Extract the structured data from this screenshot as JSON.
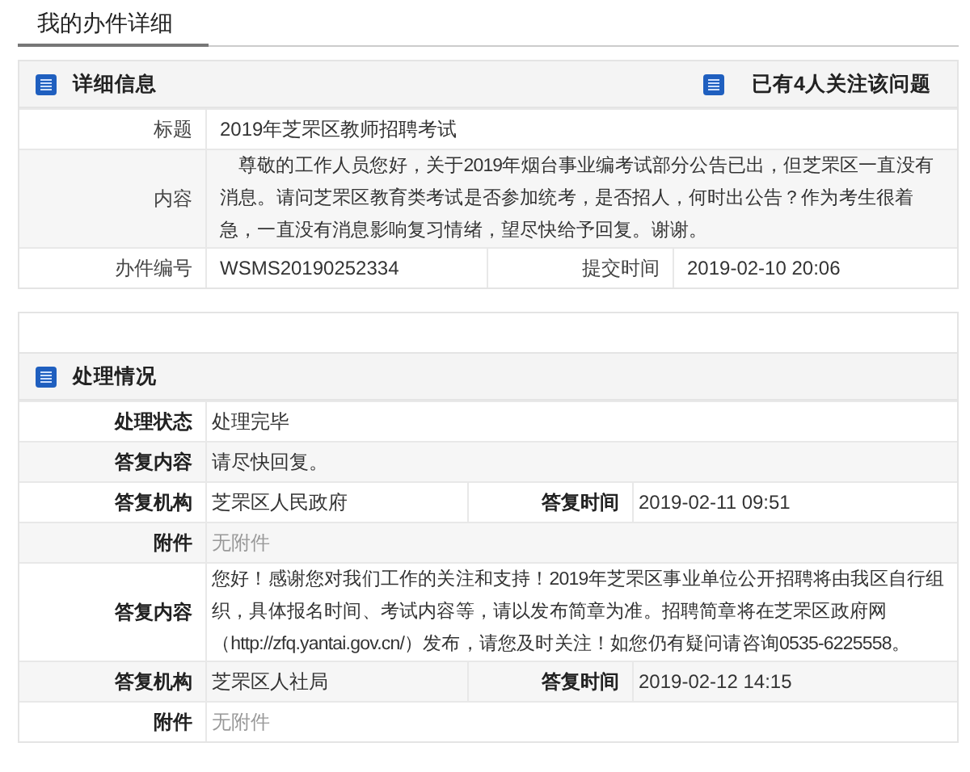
{
  "page_title": "我的办件详细",
  "detail": {
    "title": "详细信息",
    "followers": "已有4人关注该问题",
    "rows": [
      {
        "kind": "text",
        "label": "标题",
        "value": "2019年芝罘区教师招聘考试"
      },
      {
        "kind": "text",
        "label": "内容",
        "value": "尊敬的工作人员您好，关于2019年烟台事业编考试部分公告已出，但芝罘区一直没有消息。请问芝罘区教育类考试是否参加统考，是否招人，何时出公告？作为考生很着急，一直没有消息影响复习情绪，望尽快给予回复。谢谢。"
      },
      {
        "kind": "pair",
        "label": "办件编号",
        "value": "WSMS20190252334",
        "label_2": "提交时间",
        "value_2": "2019-02-10 20:06"
      }
    ]
  },
  "processing": {
    "title": "处理情况",
    "rows": [
      {
        "kind": "text",
        "label": "处理状态",
        "value": "处理完毕"
      },
      {
        "kind": "text",
        "label": "答复内容",
        "value": "请尽快回复。"
      },
      {
        "kind": "pair",
        "label": "答复机构",
        "value": "芝罘区人民政府",
        "label_2": "答复时间",
        "value_2": "2019-02-11 09:51"
      },
      {
        "kind": "attachment",
        "label": "附件",
        "value": "无附件"
      },
      {
        "kind": "text",
        "label": "答复内容",
        "value": "您好！感谢您对我们工作的关注和支持！2019年芝罘区事业单位公开招聘将由我区自行组织，具体报名时间、考试内容等，请以发布简章为准。招聘简章将在芝罘区政府网（http://zfq.yantai.gov.cn/）发布，请您及时关注！如您仍有疑问请咨询0535-6225558。"
      },
      {
        "kind": "pair",
        "label": "答复机构",
        "value": "芝罘区人社局",
        "label_2": "答复时间",
        "value_2": "2019-02-12 14:15"
      },
      {
        "kind": "attachment",
        "label": "附件",
        "value": "无附件"
      }
    ]
  }
}
